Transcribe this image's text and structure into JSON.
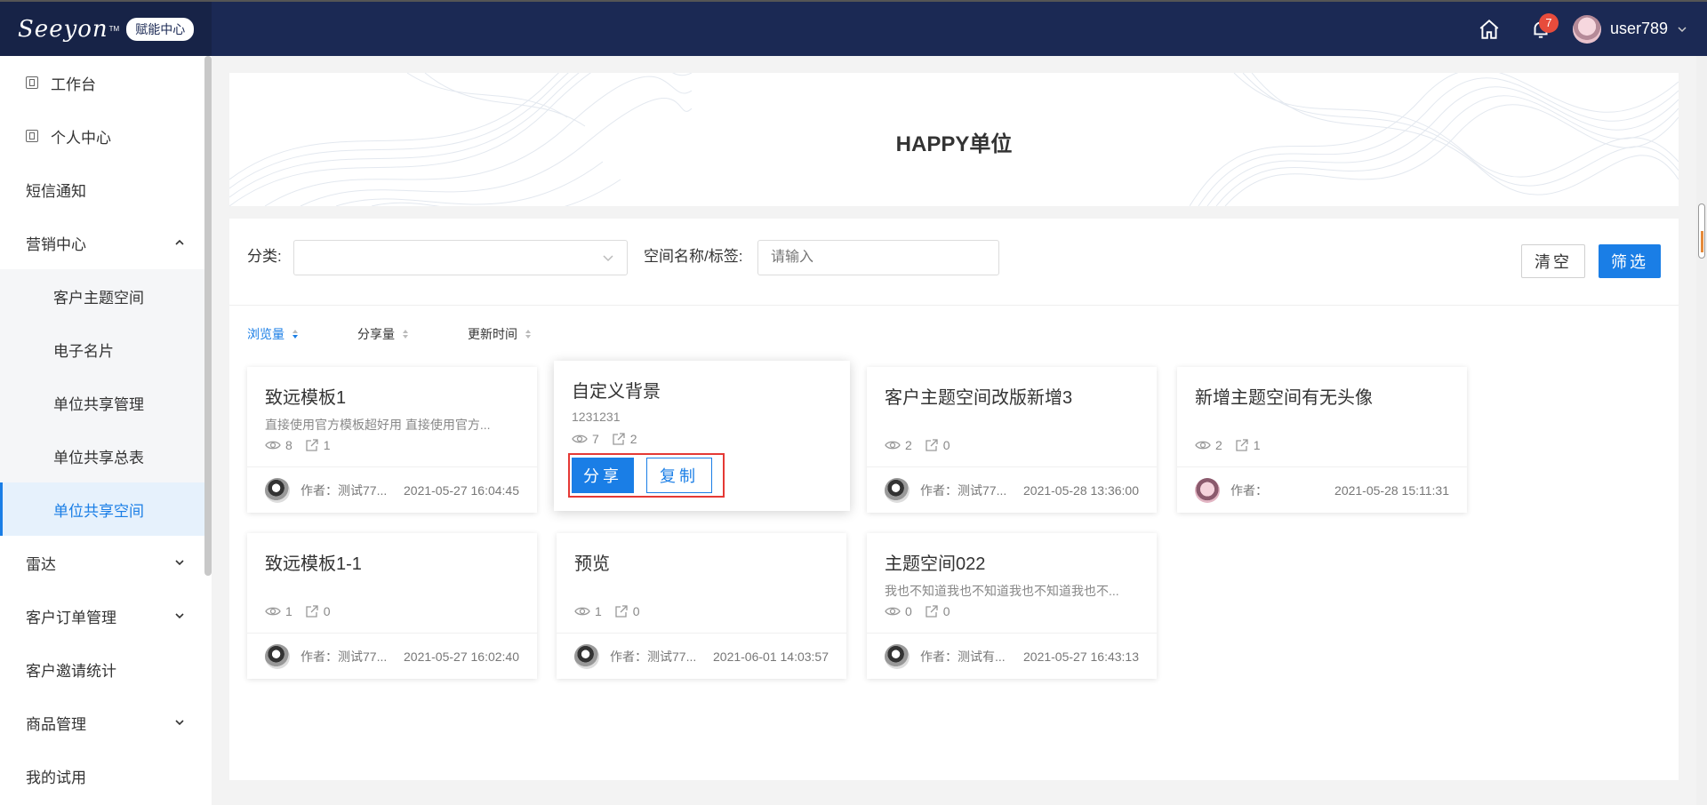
{
  "header": {
    "logo": "Seeyon",
    "logo_tm": "TM",
    "badge": "赋能中心",
    "notification_count": "7",
    "username": "user789"
  },
  "sidebar": {
    "items": [
      {
        "label": "工作台"
      },
      {
        "label": "个人中心"
      },
      {
        "label": "短信通知"
      },
      {
        "label": "营销中心"
      },
      {
        "label": "客户主题空间"
      },
      {
        "label": "电子名片"
      },
      {
        "label": "单位共享管理"
      },
      {
        "label": "单位共享总表"
      },
      {
        "label": "单位共享空间"
      },
      {
        "label": "雷达"
      },
      {
        "label": "客户订单管理"
      },
      {
        "label": "客户邀请统计"
      },
      {
        "label": "商品管理"
      },
      {
        "label": "我的试用"
      }
    ]
  },
  "banner": {
    "title": "HAPPY单位"
  },
  "filter": {
    "category_label": "分类:",
    "name_label": "空间名称/标签:",
    "name_placeholder": "请输入",
    "clear_label": "清空",
    "filter_label": "筛选"
  },
  "sort": {
    "views": "浏览量",
    "shares": "分享量",
    "updated": "更新时间"
  },
  "cards": [
    {
      "title": "致远模板1",
      "desc": "直接使用官方模板超好用 直接使用官方...",
      "views": "8",
      "shares": "1",
      "author": "作者：测试77...",
      "date": "2021-05-27 16:04:45"
    },
    {
      "title": "自定义背景",
      "desc": "1231231",
      "views": "7",
      "shares": "2",
      "share_btn": "分享",
      "copy_btn": "复制"
    },
    {
      "title": "客户主题空间改版新增3",
      "desc": "",
      "views": "2",
      "shares": "0",
      "author": "作者：测试77...",
      "date": "2021-05-28 13:36:00"
    },
    {
      "title": "新增主题空间有无头像",
      "desc": "",
      "views": "2",
      "shares": "1",
      "author": "作者：",
      "date": "2021-05-28 15:11:31"
    },
    {
      "title": "致远模板1-1",
      "desc": "",
      "views": "1",
      "shares": "0",
      "author": "作者：测试77...",
      "date": "2021-05-27 16:02:40"
    },
    {
      "title": "预览",
      "desc": "",
      "views": "1",
      "shares": "0",
      "author": "作者：测试77...",
      "date": "2021-06-01 14:03:57"
    },
    {
      "title": "主题空间022",
      "desc": "我也不知道我也不知道我也不知道我也不...",
      "views": "0",
      "shares": "0",
      "author": "作者：测试有...",
      "date": "2021-05-27 16:43:13"
    }
  ],
  "colors": {
    "header_bg": "#1b2954",
    "accent": "#1a7ee6",
    "highlight_border": "#e53935",
    "badge_red": "#e74c3c"
  },
  "icons": {
    "home": "home-icon",
    "bell": "bell-icon",
    "eye": "eye-icon",
    "share": "share-icon",
    "chevron": "chevron-down-icon"
  }
}
